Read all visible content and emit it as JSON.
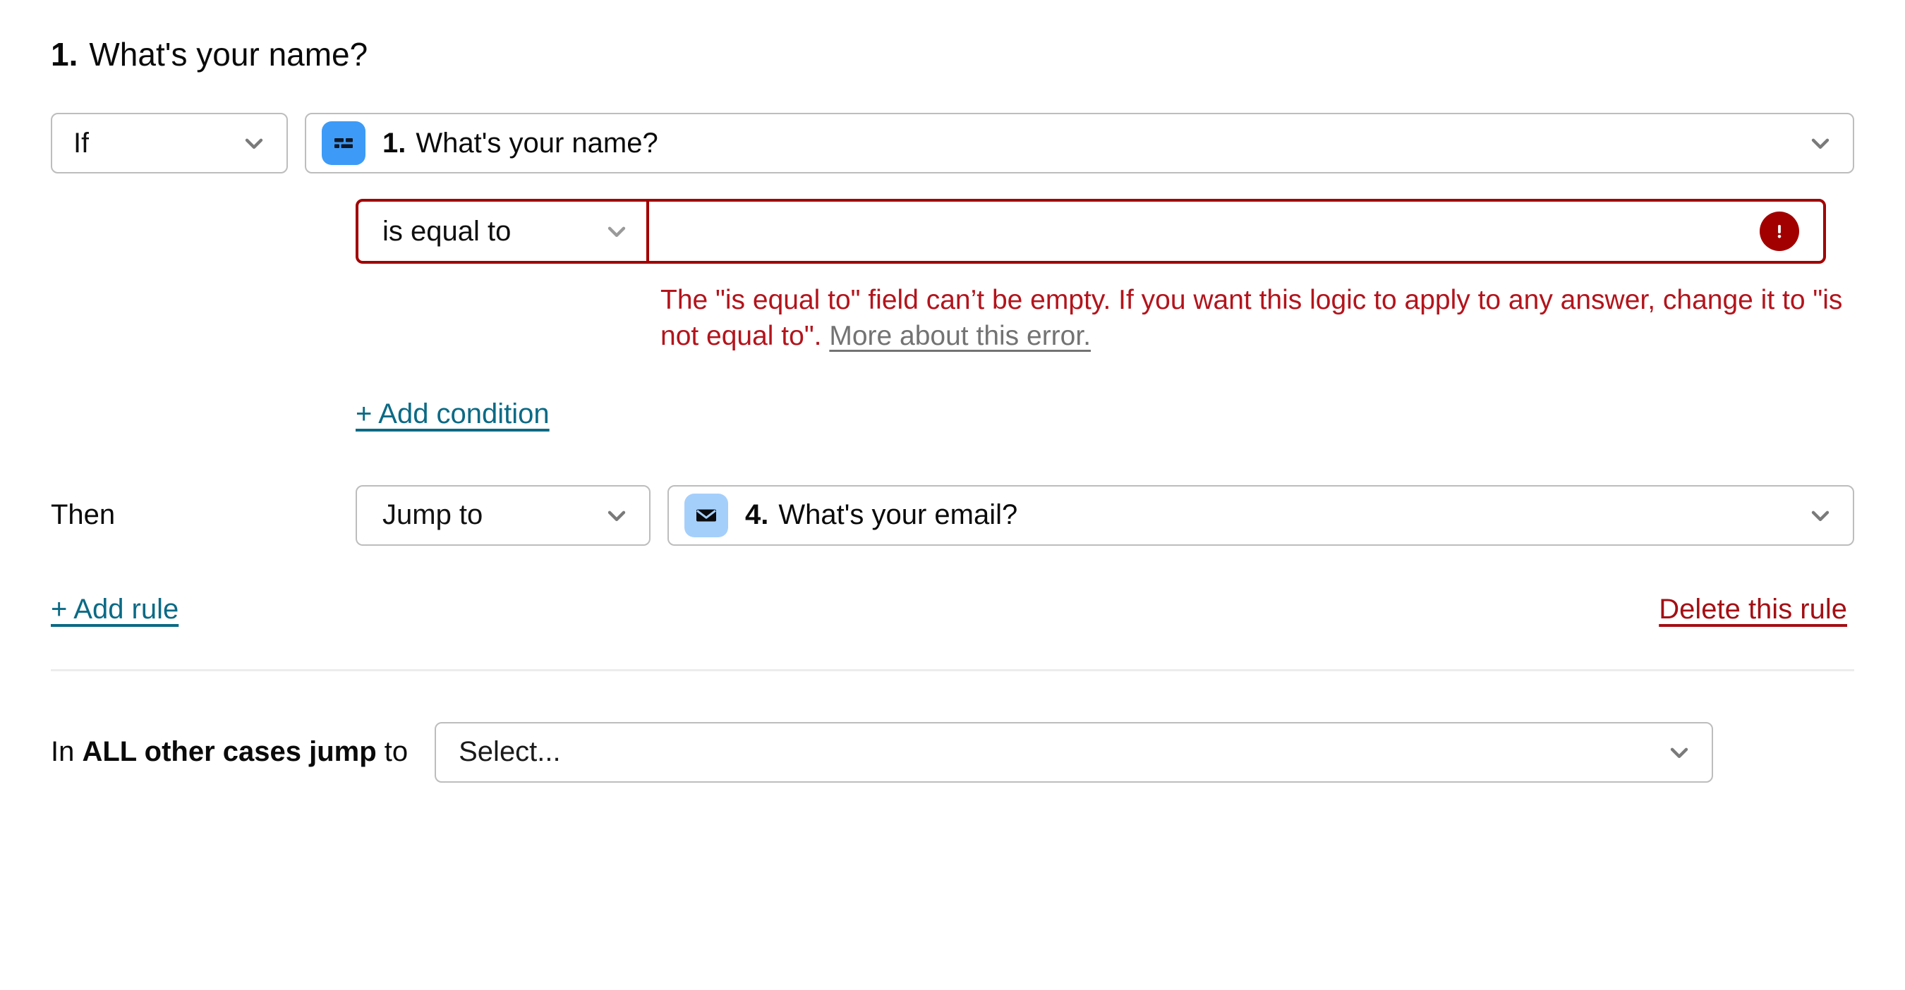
{
  "heading": {
    "number": "1.",
    "text": "What's your name?"
  },
  "rule": {
    "if_label": "If",
    "if_select_value": "If",
    "question": {
      "number": "1.",
      "text": "What's your name?",
      "icon": "short-text-icon"
    },
    "condition": {
      "operator": "is equal to",
      "value": "",
      "placeholder": "",
      "status_icon": "error-exclamation-icon",
      "error_text": "The \"is equal to\" field can’t be empty. If you want this logic to apply to any answer, change it to \"is not equal to\". ",
      "error_link": "More about this error."
    },
    "add_condition_label": "+ Add condition",
    "then_label": "Then",
    "action_select_value": "Jump to",
    "target_question": {
      "number": "4.",
      "text": "What's your email?",
      "icon": "email-icon"
    },
    "add_rule_label": "+ Add rule",
    "delete_rule_label": "Delete this rule"
  },
  "fallback": {
    "label_prefix": "In ",
    "label_bold": "ALL other cases jump",
    "label_suffix": " to",
    "select_value": "Select..."
  },
  "colors": {
    "error_border": "#a20000",
    "error_text": "#b3141c",
    "link_teal": "#0b6a85",
    "danger_link": "#a30f14",
    "icon_short_text_bg": "#3d9bf7",
    "icon_email_bg": "#a5cffb",
    "border_gray": "#bdbdbd"
  }
}
